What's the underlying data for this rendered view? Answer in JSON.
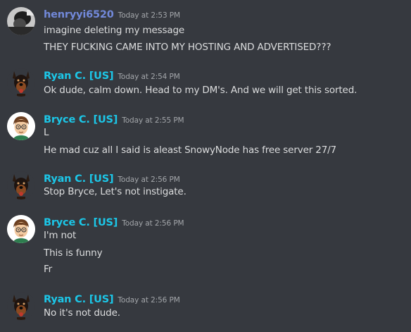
{
  "colors": {
    "background": "#36393f",
    "henryyi_name": "#7289da",
    "cyan_name": "#1cc7e8",
    "timestamp": "#a3a6aa",
    "text": "#dcddde"
  },
  "messages": [
    {
      "author": "henryyi6520",
      "avatar_icon": "grayscale-photo-avatar-icon",
      "timestamp": "Today at 2:53 PM",
      "lines": [
        "imagine deleting my message",
        "THEY FUCKING CAME INTO MY HOSTING AND ADVERTISED???"
      ]
    },
    {
      "author": "Ryan C. [US]",
      "avatar_icon": "dog-avatar-icon",
      "timestamp": "Today at 2:54 PM",
      "lines": [
        "Ok dude, calm down. Head to my DM's. And we will get this sorted."
      ]
    },
    {
      "author": "Bryce C. [US]",
      "avatar_icon": "cartoon-face-avatar-icon",
      "timestamp": "Today at 2:55 PM",
      "lines": [
        "L",
        "He mad cuz all I said is aleast SnowyNode has free server 27/7"
      ]
    },
    {
      "author": "Ryan C. [US]",
      "avatar_icon": "dog-avatar-icon",
      "timestamp": "Today at 2:56 PM",
      "lines": [
        "Stop Bryce, Let's not instigate."
      ]
    },
    {
      "author": "Bryce C. [US]",
      "avatar_icon": "cartoon-face-avatar-icon",
      "timestamp": "Today at 2:56 PM",
      "lines": [
        "I'm not",
        "This is funny",
        "Fr"
      ]
    },
    {
      "author": "Ryan C. [US]",
      "avatar_icon": "dog-avatar-icon",
      "timestamp": "Today at 2:56 PM",
      "lines": [
        "No it's not dude."
      ]
    }
  ]
}
